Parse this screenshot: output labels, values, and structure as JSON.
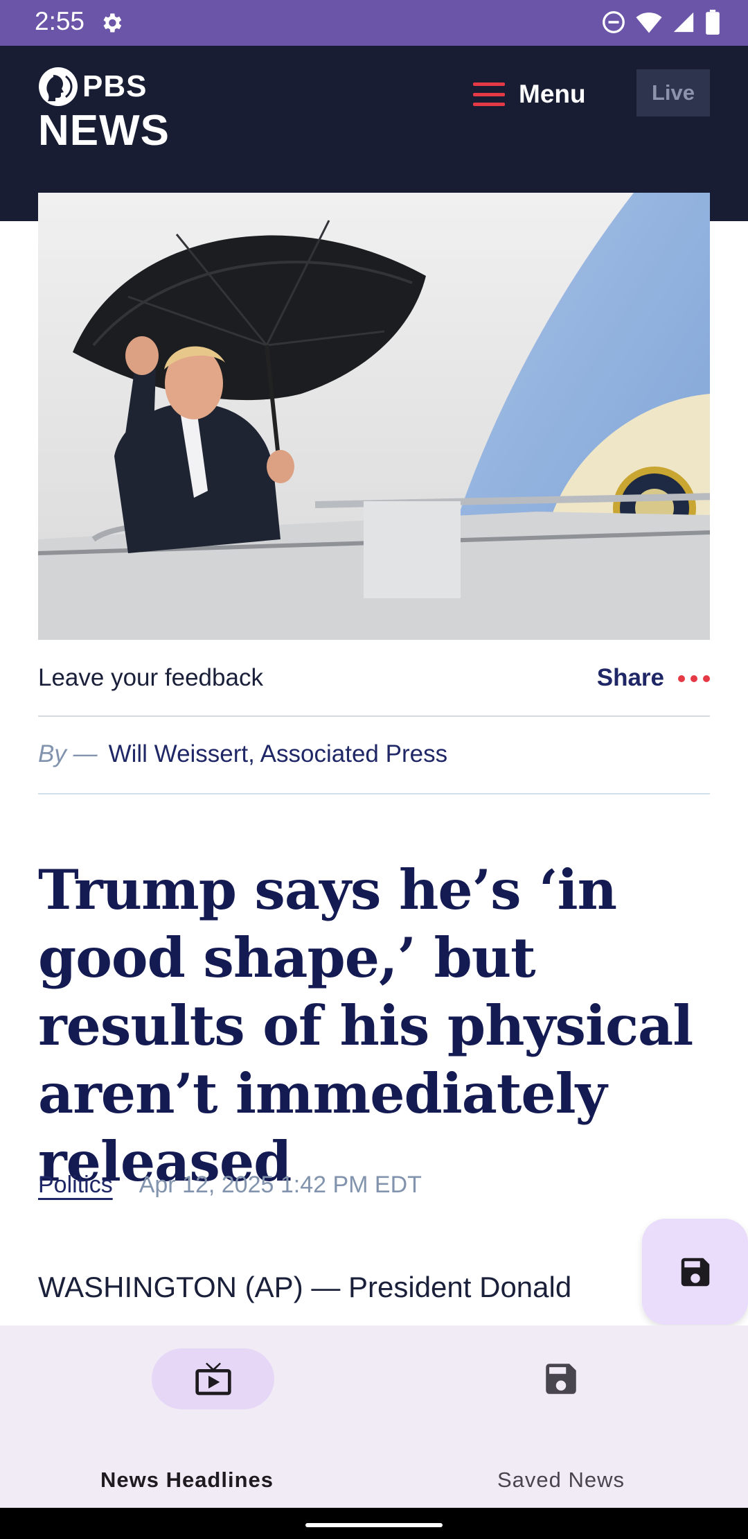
{
  "status_bar": {
    "time": "2:55"
  },
  "header": {
    "logo_top": "PBS",
    "logo_bottom": "NEWS",
    "menu_label": "Menu",
    "live_label": "Live"
  },
  "article": {
    "feedback_label": "Leave your feedback",
    "share_label": "Share",
    "byline_prefix": "By —",
    "author": "Will Weissert, Associated Press",
    "headline": "Trump says he’s ‘in good shape,’ but results of his physical aren’t immediately released",
    "category": "Politics",
    "date": "Apr 12, 2025 1:42 PM EDT",
    "body_start": "WASHINGTON (AP) — President Donald"
  },
  "bottom_nav": {
    "items": [
      {
        "label": "News Headlines",
        "icon": "live-tv-icon",
        "selected": true
      },
      {
        "label": "Saved News",
        "icon": "save-icon",
        "selected": false
      }
    ]
  },
  "colors": {
    "status_bar": "#6b55a8",
    "header": "#191d34",
    "accent_red": "#e63946",
    "headline": "#141a52",
    "nav_background": "#f1ebf6",
    "fab_background": "#eadcfb"
  }
}
